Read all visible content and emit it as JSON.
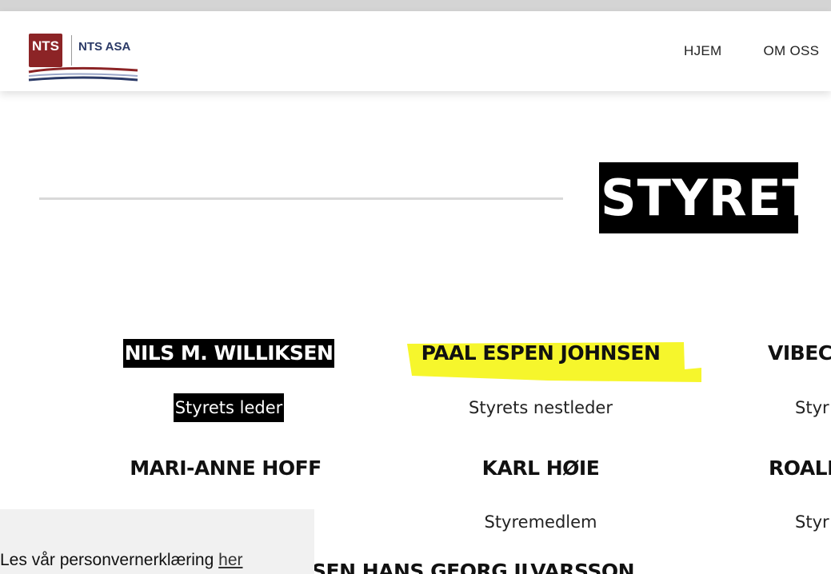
{
  "header": {
    "logo": {
      "badge_text": "NTS",
      "company_name": "NTS ASA"
    },
    "nav": {
      "items": [
        "HJEM",
        "OM OSS"
      ]
    }
  },
  "main": {
    "title": "STYRET",
    "members": [
      {
        "name": "NILS M. WILLIKSEN",
        "role": "Styrets leder"
      },
      {
        "name": "PAAL ESPEN JOHNSEN",
        "role": "Styrets nestleder"
      },
      {
        "name": "VIBEC",
        "role": "Styr"
      },
      {
        "name": "MARI-ANNE HOFF",
        "role": ""
      },
      {
        "name": "KARL HØIE",
        "role": "Styremedlem"
      },
      {
        "name": "ROALD",
        "role": "Styr"
      }
    ],
    "next_row_partial": "SEN      HANS GEORG ILVARSSON"
  },
  "cookie_banner": {
    "text": "Les vår personvernerklæring",
    "link_label": "her"
  },
  "colors": {
    "brand_red": "#8c2426",
    "brand_navy": "#2b3a67",
    "highlight_yellow": "#f5f51a"
  }
}
